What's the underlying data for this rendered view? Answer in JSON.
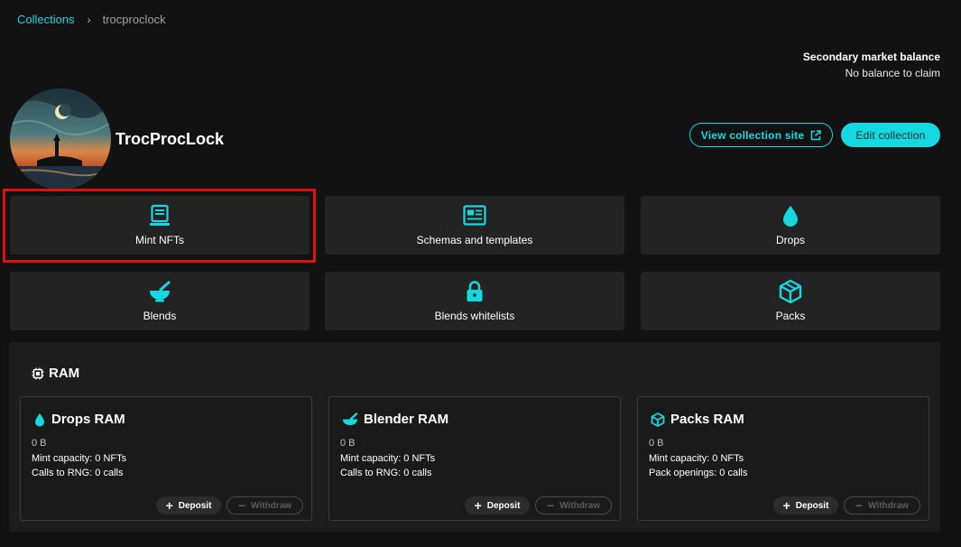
{
  "breadcrumb": {
    "root": "Collections",
    "separator": "›",
    "current": "trocproclock"
  },
  "balance": {
    "title": "Secondary market balance",
    "value": "No balance to claim"
  },
  "collection": {
    "name": "TrocProcLock",
    "view_site_label": "View collection site",
    "edit_label": "Edit collection"
  },
  "tiles": [
    {
      "label": "Mint NFTs",
      "icon": "tablet-icon"
    },
    {
      "label": "Schemas and templates",
      "icon": "newspaper-icon"
    },
    {
      "label": "Drops",
      "icon": "droplet-icon"
    },
    {
      "label": "Blends",
      "icon": "mortar-pestle-icon"
    },
    {
      "label": "Blends whitelists",
      "icon": "lock-icon"
    },
    {
      "label": "Packs",
      "icon": "box-icon"
    }
  ],
  "ram": {
    "title": "RAM",
    "cards": [
      {
        "title": "Drops RAM",
        "icon": "droplet-icon",
        "bytes": "0 B",
        "line1": "Mint capacity: 0 NFTs",
        "line2": "Calls to RNG: 0 calls",
        "deposit": "Deposit",
        "withdraw": "Withdraw"
      },
      {
        "title": "Blender RAM",
        "icon": "mortar-pestle-icon",
        "bytes": "0 B",
        "line1": "Mint capacity: 0 NFTs",
        "line2": "Calls to RNG: 0 calls",
        "deposit": "Deposit",
        "withdraw": "Withdraw"
      },
      {
        "title": "Packs RAM",
        "icon": "box-icon",
        "bytes": "0 B",
        "line1": "Mint capacity: 0 NFTs",
        "line2": "Pack openings: 0 calls",
        "deposit": "Deposit",
        "withdraw": "Withdraw"
      }
    ]
  },
  "colors": {
    "accent": "#15d9e1",
    "background": "#121212",
    "tile": "#232323",
    "highlight": "#e01010"
  }
}
